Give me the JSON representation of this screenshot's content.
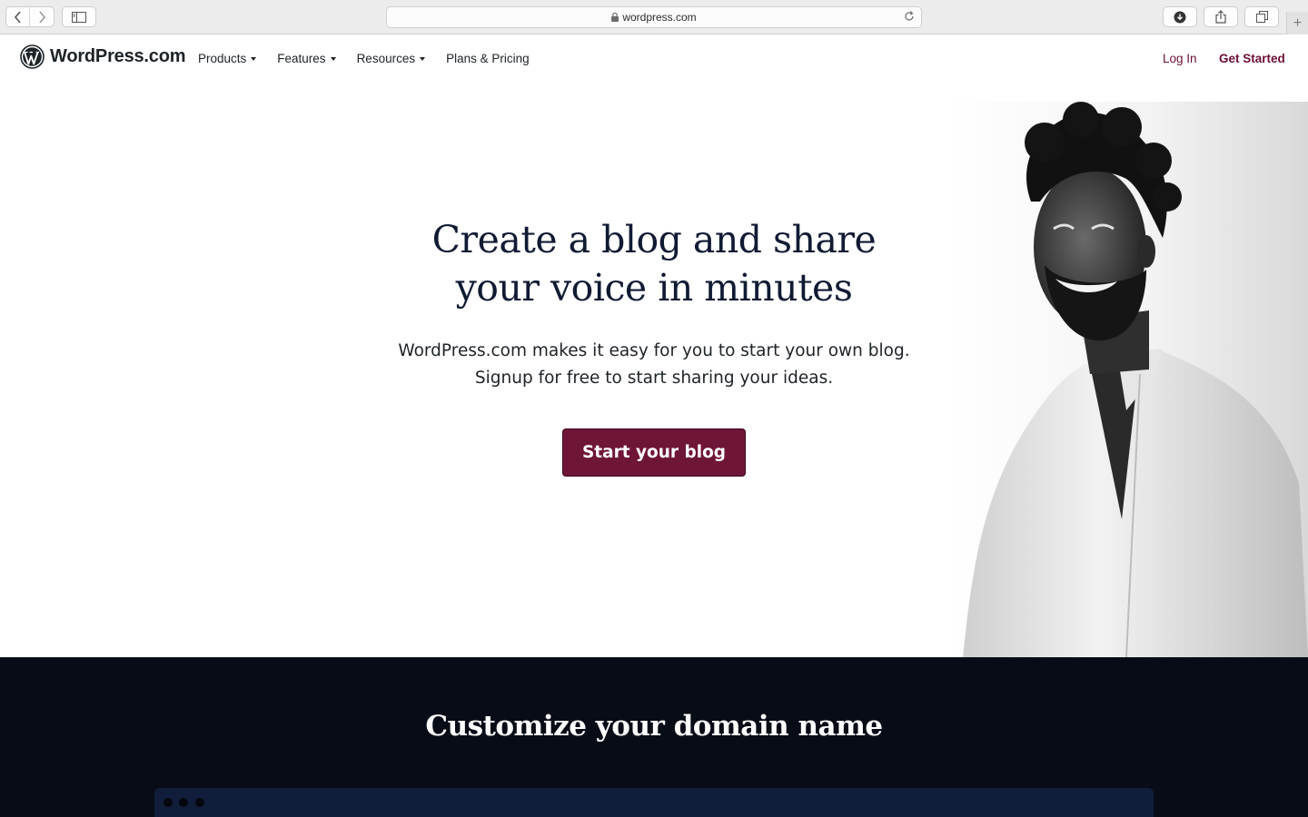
{
  "browser": {
    "url": "wordpress.com",
    "icons": [
      "back-icon",
      "forward-icon",
      "sidebar-icon",
      "lock-icon",
      "reload-icon",
      "download-icon",
      "share-icon",
      "tabs-icon",
      "new-tab-icon"
    ]
  },
  "header": {
    "logo_text": "WordPress.com",
    "nav": [
      {
        "label": "Products",
        "dropdown": true
      },
      {
        "label": "Features",
        "dropdown": true
      },
      {
        "label": "Resources",
        "dropdown": true
      },
      {
        "label": "Plans & Pricing",
        "dropdown": false
      }
    ],
    "login": "Log In",
    "get_started": "Get Started"
  },
  "hero": {
    "title_line1": "Create a blog and share",
    "title_line2": "your voice in minutes",
    "subtitle_line1": "WordPress.com makes it easy for you to start your own blog.",
    "subtitle_line2": "Signup for free to start sharing your ideas.",
    "cta": "Start your blog"
  },
  "section2": {
    "title": "Customize your domain name"
  },
  "colors": {
    "brand": "#6f1538",
    "dark_bg": "#080c17",
    "heading": "#101a33"
  }
}
